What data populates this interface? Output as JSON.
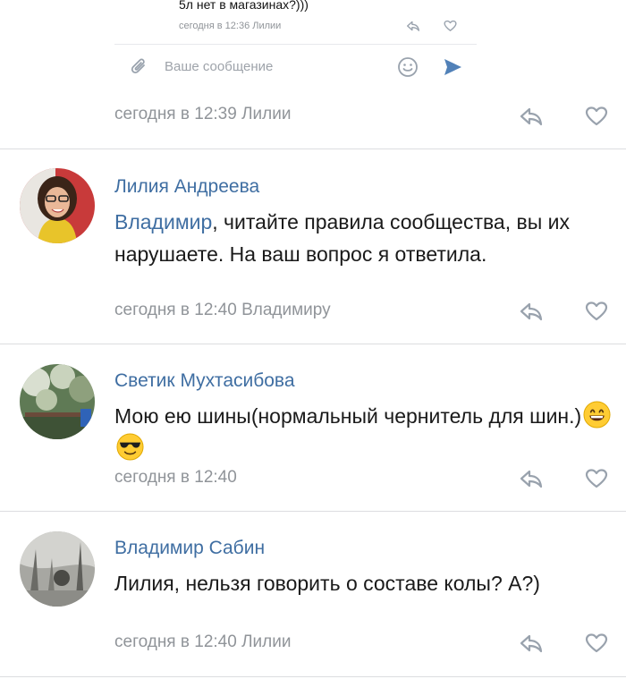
{
  "quoted": {
    "text": "5л нет в магазинах?)))",
    "meta": "сегодня в 12:36 Лилии",
    "composer_placeholder": "Ваше сообщение"
  },
  "top_meta": "сегодня в 12:39 Лилии",
  "comments": [
    {
      "author": "Лилия Андреева",
      "mention": "Владимир",
      "text": ", читайте правила сообщества, вы их нарушаете. На ваш вопрос я ответила.",
      "meta": "сегодня в 12:40 Владимиру"
    },
    {
      "author": "Светик Мухтасибова",
      "text": "Мою ею шины(нормальный чернитель для шин.)",
      "emojis": [
        "grinning-face",
        "smiling-face-with-sunglasses"
      ],
      "meta": "сегодня в 12:40"
    },
    {
      "author": "Владимир Сабин",
      "text": "Лилия, нельзя говорить о составе колы? А?)",
      "meta": "сегодня в 12:40 Лилии"
    }
  ],
  "colors": {
    "author": "#3f6ea2",
    "meta": "#909499",
    "icon": "#99a2ad",
    "send": "#5181b8"
  }
}
